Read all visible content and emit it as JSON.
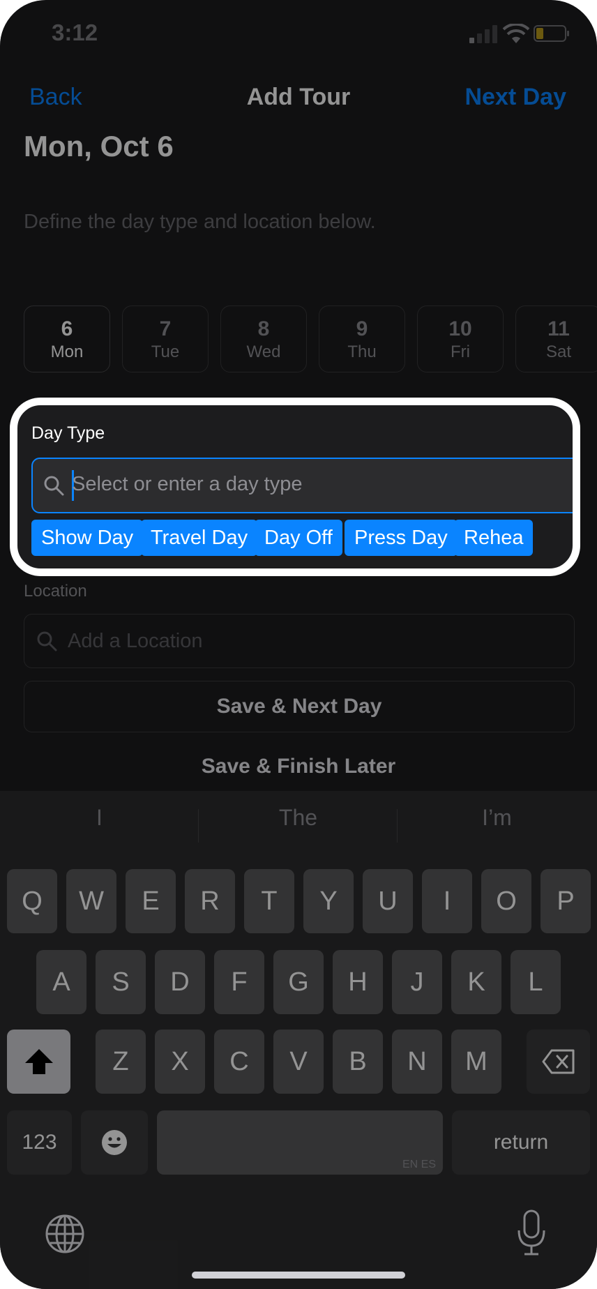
{
  "status_bar": {
    "time": "3:12"
  },
  "nav": {
    "back_label": "Back",
    "title": "Add Tour",
    "next_label": "Next Day"
  },
  "header": {
    "date": "Mon, Oct 6",
    "subtitle": "Define the day type and location below."
  },
  "days": [
    {
      "num": "6",
      "dow": "Mon",
      "selected": true
    },
    {
      "num": "7",
      "dow": "Tue"
    },
    {
      "num": "8",
      "dow": "Wed"
    },
    {
      "num": "9",
      "dow": "Thu"
    },
    {
      "num": "10",
      "dow": "Fri"
    },
    {
      "num": "11",
      "dow": "Sat"
    }
  ],
  "day_type": {
    "label": "Day Type",
    "placeholder": "Select or enter a day type",
    "options": [
      "Show Day",
      "Travel Day",
      "Day Off",
      "Press Day",
      "Rehea"
    ]
  },
  "location": {
    "label": "Location",
    "placeholder": "Add a Location"
  },
  "actions": {
    "save_next": "Save & Next Day",
    "save_later": "Save & Finish Later"
  },
  "keyboard": {
    "suggestions": [
      "I",
      "The",
      "I’m"
    ],
    "row1": [
      "Q",
      "W",
      "E",
      "R",
      "T",
      "Y",
      "U",
      "I",
      "O",
      "P"
    ],
    "row2": [
      "A",
      "S",
      "D",
      "F",
      "G",
      "H",
      "J",
      "K",
      "L"
    ],
    "row3": [
      "Z",
      "X",
      "C",
      "V",
      "B",
      "N",
      "M"
    ],
    "numbers_label": "123",
    "return_label": "return",
    "space_hint": "EN ES"
  },
  "colors": {
    "accent": "#0a84ff",
    "background": "#1c1c1e",
    "keyboard_bg": "#2c2c2e"
  }
}
